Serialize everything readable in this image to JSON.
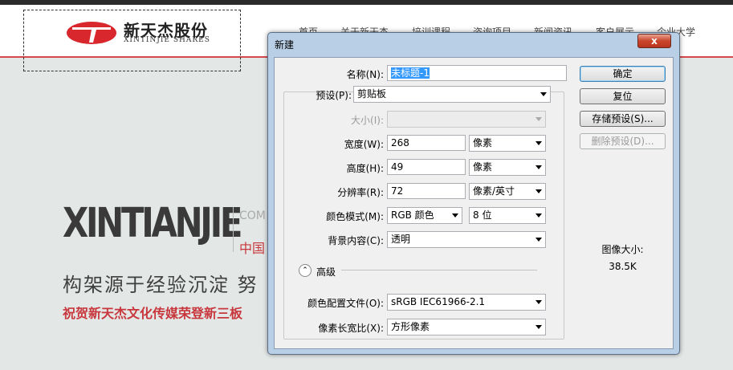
{
  "site": {
    "logo_cn": "新天杰股份",
    "logo_en": "XINTINJIE SHARES",
    "nav": [
      "首页",
      "关于新天杰",
      "培训课程",
      "咨询项目",
      "新闻资讯",
      "客户展示",
      "企业大学"
    ],
    "hero_big": "XINTIANJIE",
    "hero_com": "COM",
    "hero_cn_red": "中国",
    "hero_line2": "构架源于经验沉淀  努",
    "hero_line3": "祝贺新天杰文化传媒荣登新三板",
    "colors": {
      "accent_red": "#c8373d"
    }
  },
  "dialog": {
    "title": "新建",
    "close": "x",
    "name_label": "名称(N):",
    "name_value": "未标题-1",
    "preset_label": "预设(P):",
    "preset_value": "剪贴板",
    "size_label": "大小(I):",
    "width_label": "宽度(W):",
    "width_value": "268",
    "width_unit": "像素",
    "height_label": "高度(H):",
    "height_value": "49",
    "height_unit": "像素",
    "res_label": "分辨率(R):",
    "res_value": "72",
    "res_unit": "像素/英寸",
    "mode_label": "颜色模式(M):",
    "mode_value": "RGB 颜色",
    "bits_value": "8 位",
    "bg_label": "背景内容(C):",
    "bg_value": "透明",
    "advanced_label": "高级",
    "profile_label": "颜色配置文件(O):",
    "profile_value": "sRGB IEC61966-2.1",
    "aspect_label": "像素长宽比(X):",
    "aspect_value": "方形像素",
    "buttons": {
      "ok": "确定",
      "reset": "复位",
      "save_preset": "存储预设(S)...",
      "delete_preset": "删除预设(D)..."
    },
    "image_size_label": "图像大小:",
    "image_size_value": "38.5K"
  }
}
